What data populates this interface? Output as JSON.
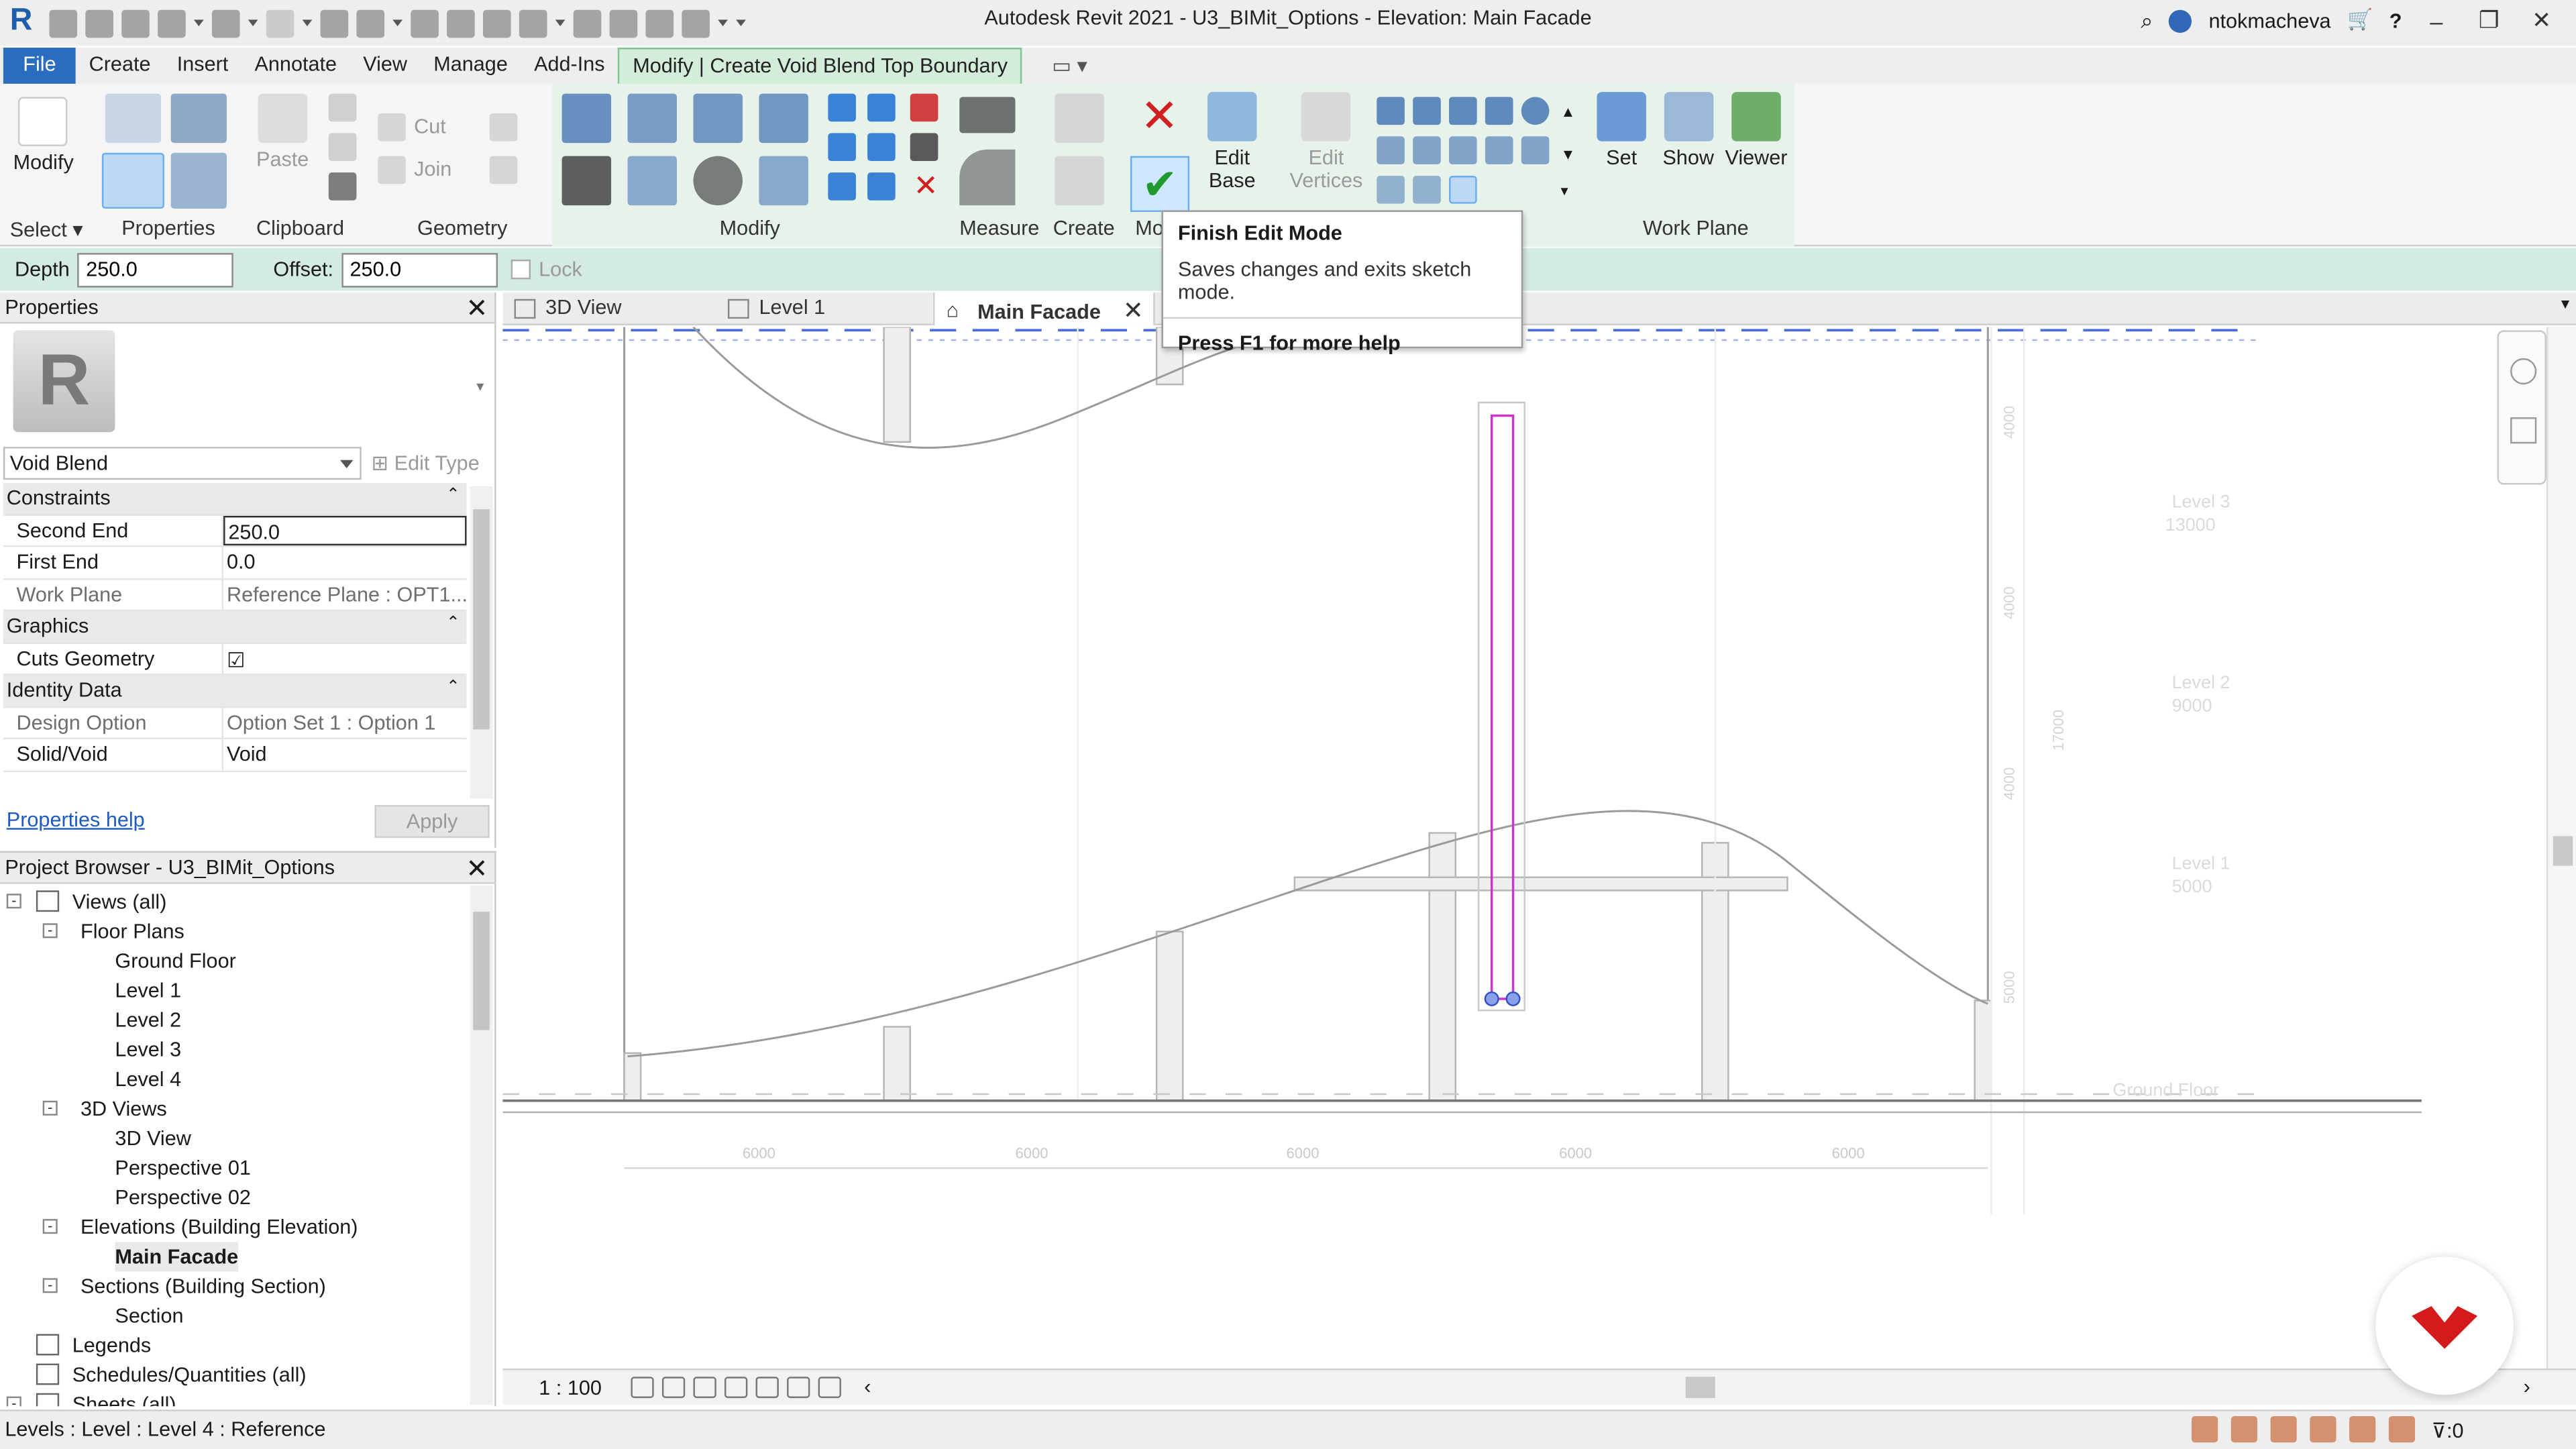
{
  "window": {
    "title": "Autodesk Revit 2021 - U3_BIMit_Options - Elevation: Main Facade",
    "user": "ntokmacheva"
  },
  "ribbon_tabs": [
    "File",
    "Create",
    "Insert",
    "Annotate",
    "View",
    "Manage",
    "Add-Ins",
    "Modify | Create Void Blend Top Boundary"
  ],
  "ribbon": {
    "modify_label": "Modify",
    "paste_label": "Paste",
    "cut_label": "Cut",
    "join_label": "Join",
    "edit_base_label": "Edit\nBase",
    "edit_vertices_label": "Edit\nVertices",
    "set_label": "Set",
    "show_label": "Show",
    "viewer_label": "Viewer",
    "panels": {
      "select": "Select",
      "properties": "Properties",
      "clipboard": "Clipboard",
      "geometry": "Geometry",
      "modify": "Modify",
      "measure": "Measure",
      "create": "Create",
      "mode_partial": "Mo",
      "work_plane": "Work Plane"
    }
  },
  "tooltip": {
    "title": "Finish Edit Mode",
    "description": "Saves changes and exits sketch mode.",
    "help": "Press F1 for more help"
  },
  "options_bar": {
    "depth_label": "Depth",
    "depth_value": "250.0",
    "offset_label": "Offset:",
    "offset_value": "250.0",
    "lock_label": "Lock"
  },
  "properties": {
    "title": "Properties",
    "type_name": "Void Blend",
    "edit_type_label": "Edit Type",
    "groups": [
      {
        "name": "Constraints",
        "rows": [
          {
            "key": "Second End",
            "value": "250.0",
            "editing": true
          },
          {
            "key": "First End",
            "value": "0.0"
          },
          {
            "key": "Work Plane",
            "value": "Reference Plane : OPT1...",
            "readonly": true
          }
        ]
      },
      {
        "name": "Graphics",
        "rows": [
          {
            "key": "Cuts Geometry",
            "value": "☑"
          }
        ]
      },
      {
        "name": "Identity Data",
        "rows": [
          {
            "key": "Design Option",
            "value": "Option Set 1 : Option 1",
            "readonly": true
          },
          {
            "key": "Solid/Void",
            "value": "Void"
          }
        ]
      }
    ],
    "help_link": "Properties help",
    "apply_label": "Apply"
  },
  "project_browser": {
    "title": "Project Browser - U3_BIMit_Options",
    "nodes": [
      {
        "label": "Views (all)",
        "depth": 0,
        "toggle": "-",
        "icon": true
      },
      {
        "label": "Floor Plans",
        "depth": 1,
        "toggle": "-"
      },
      {
        "label": "Ground Floor",
        "depth": 2
      },
      {
        "label": "Level 1",
        "depth": 2
      },
      {
        "label": "Level 2",
        "depth": 2
      },
      {
        "label": "Level 3",
        "depth": 2
      },
      {
        "label": "Level 4",
        "depth": 2
      },
      {
        "label": "3D Views",
        "depth": 1,
        "toggle": "-"
      },
      {
        "label": "3D View",
        "depth": 2
      },
      {
        "label": "Perspective 01",
        "depth": 2
      },
      {
        "label": "Perspective 02",
        "depth": 2
      },
      {
        "label": "Elevations (Building Elevation)",
        "depth": 1,
        "toggle": "-"
      },
      {
        "label": "Main Facade",
        "depth": 2,
        "selected": true
      },
      {
        "label": "Sections (Building Section)",
        "depth": 1,
        "toggle": "-"
      },
      {
        "label": "Section",
        "depth": 2
      },
      {
        "label": "Legends",
        "depth": 0,
        "icon": true
      },
      {
        "label": "Schedules/Quantities (all)",
        "depth": 0,
        "icon": true
      },
      {
        "label": "Sheets (all)",
        "depth": 0,
        "toggle": "-",
        "icon": true
      }
    ]
  },
  "view_tabs": [
    {
      "label": "3D View"
    },
    {
      "label": "Level 1"
    },
    {
      "label": "Main Facade",
      "active": true
    }
  ],
  "canvas": {
    "level_tags": [
      {
        "name": "Level 3",
        "elev": "13000"
      },
      {
        "name": "Level 2",
        "elev": "9000"
      },
      {
        "name": "Level 1",
        "elev": "5000"
      },
      {
        "name": "Ground Floor",
        "elev": ""
      }
    ],
    "grid_dims": [
      "6000",
      "6000",
      "6000",
      "6000",
      "6000"
    ],
    "vertical_dims": [
      "4000",
      "4000",
      "4000",
      "5000"
    ],
    "total_dim": "17000"
  },
  "view_control": {
    "scale": "1 : 100"
  },
  "status": {
    "text": "Levels : Level : Level 4 : Reference",
    "filter_count": ":0"
  },
  "colors": {
    "file_tab": "#2a6cbf",
    "contextual_tab": "#d4ecda",
    "options_bar": "#d3ebe1",
    "sketch_line": "#cc33cc",
    "finish_check": "#1f9a2f",
    "cancel_x": "#d02020"
  }
}
